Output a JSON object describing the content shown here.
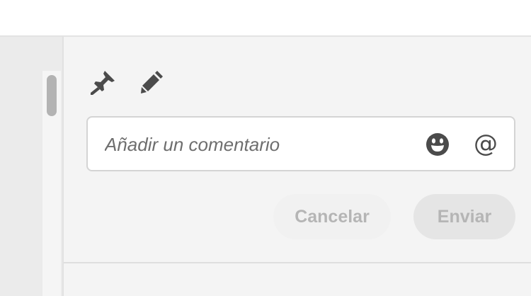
{
  "toolbar": {
    "pin_icon": "pin-icon",
    "pencil_icon": "pencil-icon"
  },
  "comment": {
    "placeholder": "Añadir un comentario",
    "value": "",
    "emoji_icon": "smiley-icon",
    "mention_label": "@"
  },
  "actions": {
    "cancel_label": "Cancelar",
    "send_label": "Enviar"
  },
  "colors": {
    "panel_background": "#f4f4f4",
    "disabled_text": "#b5b5b5",
    "icon": "#4b4b4b"
  }
}
